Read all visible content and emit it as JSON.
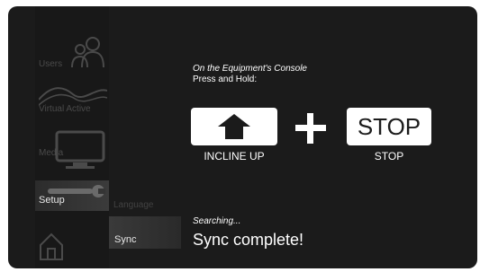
{
  "sidebar": {
    "items": [
      {
        "label": "Users",
        "icon": "users-icon"
      },
      {
        "label": "Virtual Active",
        "icon": "mountains-icon"
      },
      {
        "label": "Media",
        "icon": "tv-icon"
      },
      {
        "label": "Setup",
        "icon": "wrench-icon"
      },
      {
        "label": "",
        "icon": "home-icon"
      }
    ]
  },
  "submenu": {
    "items": [
      {
        "label": "Language"
      },
      {
        "label": "Sync"
      }
    ]
  },
  "instructions": {
    "line1": "On the Equipment's Console",
    "line2": "Press and Hold:"
  },
  "buttons": {
    "incline": {
      "label": "INCLINE UP",
      "icon": "arrow-up-icon"
    },
    "plus": "+",
    "stop": {
      "text": "STOP",
      "label": "STOP"
    }
  },
  "status": {
    "searching": "Searching...",
    "result": "Sync complete!"
  },
  "colors": {
    "background": "#1b1b1b",
    "text": "#ffffff",
    "dim_text": "#4a4a4a",
    "button_bg": "#ffffff"
  }
}
